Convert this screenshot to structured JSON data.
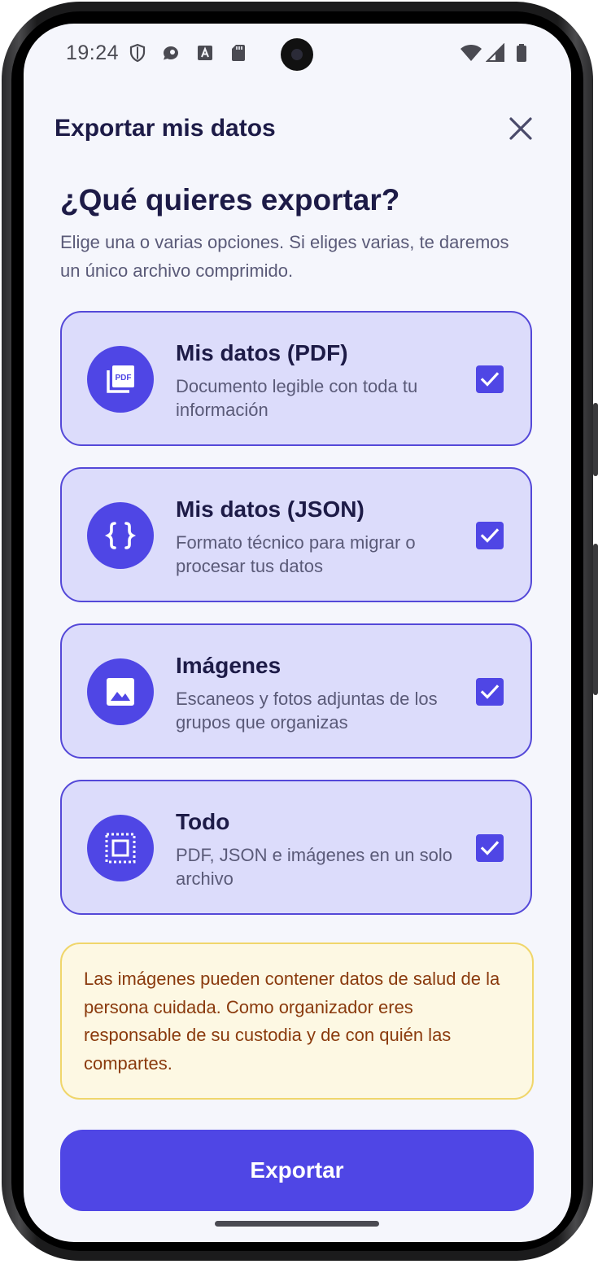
{
  "status_bar": {
    "time": "19:24",
    "left_icons": [
      "shield-icon",
      "chat-icon",
      "text-a-icon",
      "sd-card-icon"
    ],
    "right_icons": [
      "wifi-icon",
      "signal-icon",
      "battery-icon"
    ]
  },
  "header": {
    "title": "Exportar mis datos",
    "close_icon": "close-icon"
  },
  "intro": {
    "heading": "¿Qué quieres exportar?",
    "subtitle": "Elige una o varias opciones. Si eliges varias, te daremos un único archivo comprimido."
  },
  "options": [
    {
      "title": "Mis datos (PDF)",
      "description": "Documento legible con toda tu información",
      "icon": "pdf-icon",
      "checked": true
    },
    {
      "title": "Mis datos (JSON)",
      "description": "Formato técnico para migrar o procesar tus datos",
      "icon": "json-braces-icon",
      "checked": true
    },
    {
      "title": "Imágenes",
      "description": "Escaneos y fotos adjuntas de los grupos que organizas",
      "icon": "image-icon",
      "checked": true
    },
    {
      "title": "Todo",
      "description": "PDF, JSON e imágenes en un solo archivo",
      "icon": "select-all-icon",
      "checked": true
    }
  ],
  "warning": {
    "text": "Las imágenes pueden contener datos de salud de la persona cuidada. Como organizador eres responsable de su custodia y de con quién las compartes."
  },
  "actions": {
    "export_label": "Exportar"
  },
  "colors": {
    "accent": "#4f46e5",
    "card_background": "#dcdcfb",
    "screen_background": "#f5f6fc",
    "warning_background": "#fdf8e3",
    "warning_border": "#f0d66b",
    "warning_text": "#8a3a0d",
    "title_text": "#1d1b47"
  }
}
